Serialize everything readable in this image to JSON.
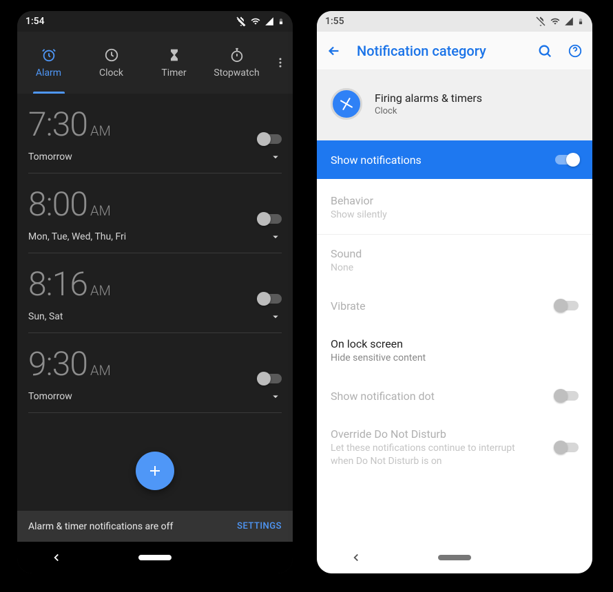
{
  "left": {
    "status_time": "1:54",
    "tabs": [
      {
        "label": "Alarm",
        "icon": "alarm-icon"
      },
      {
        "label": "Clock",
        "icon": "clock-icon"
      },
      {
        "label": "Timer",
        "icon": "hourglass-icon"
      },
      {
        "label": "Stopwatch",
        "icon": "stopwatch-icon"
      }
    ],
    "active_tab": 0,
    "alarms": [
      {
        "time": "7:30",
        "ampm": "AM",
        "schedule": "Tomorrow",
        "enabled": false
      },
      {
        "time": "8:00",
        "ampm": "AM",
        "schedule": "Mon, Tue, Wed, Thu, Fri",
        "enabled": false
      },
      {
        "time": "8:16",
        "ampm": "AM",
        "schedule": "Sun, Sat",
        "enabled": false
      },
      {
        "time": "9:30",
        "ampm": "AM",
        "schedule": "Tomorrow",
        "enabled": false
      }
    ],
    "warning": {
      "text": "Alarm & timer notifications are off",
      "action": "SETTINGS"
    }
  },
  "right": {
    "status_time": "1:55",
    "header_title": "Notification category",
    "channel": {
      "name": "Firing alarms & timers",
      "sub": "Clock"
    },
    "show_notifications": {
      "label": "Show notifications",
      "value": true
    },
    "prefs": [
      {
        "title": "Behavior",
        "sub": "Show silently",
        "disabled": true,
        "toggle": null
      },
      {
        "title": "Sound",
        "sub": "None",
        "disabled": true,
        "toggle": null
      },
      {
        "title": "Vibrate",
        "sub": null,
        "disabled": true,
        "toggle": false
      },
      {
        "title": "On lock screen",
        "sub": "Hide sensitive content",
        "disabled": false,
        "toggle": null
      },
      {
        "title": "Show notification dot",
        "sub": null,
        "disabled": true,
        "toggle": false
      },
      {
        "title": "Override Do Not Disturb",
        "sub": "Let these notifications continue to interrupt when Do Not Disturb is on",
        "disabled": true,
        "toggle": false
      }
    ]
  }
}
